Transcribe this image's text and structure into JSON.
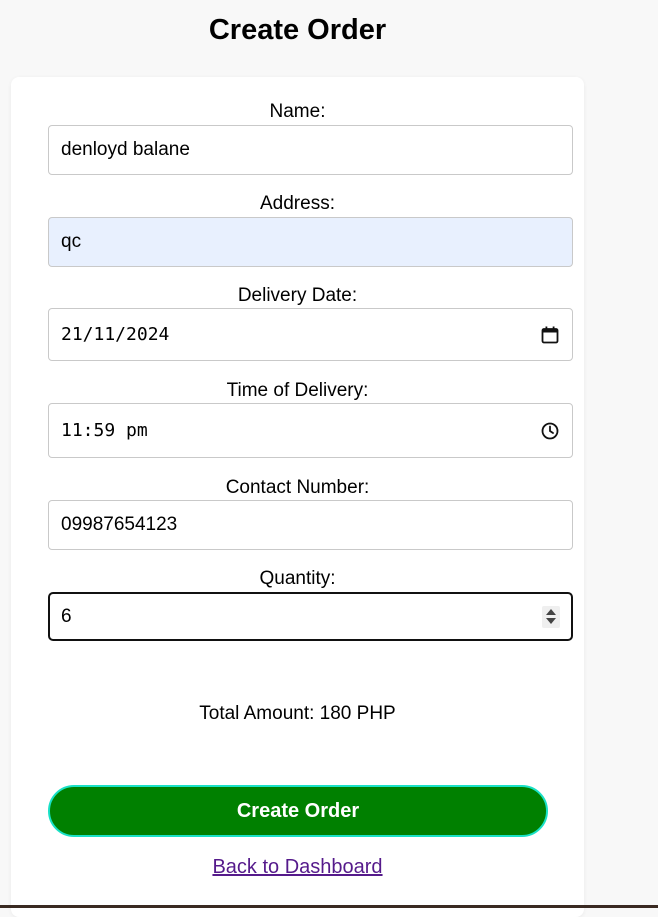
{
  "page": {
    "title": "Create Order"
  },
  "form": {
    "name": {
      "label": "Name:",
      "value": "denloyd balane"
    },
    "address": {
      "label": "Address:",
      "value": "qc"
    },
    "delivery_date": {
      "label": "Delivery Date:",
      "value": "21/11/2024",
      "icon": "calendar-icon"
    },
    "delivery_time": {
      "label": "Time of Delivery:",
      "value": "11:59 pm",
      "icon": "clock-icon"
    },
    "contact": {
      "label": "Contact Number:",
      "value": "09987654123"
    },
    "quantity": {
      "label": "Quantity:",
      "value": "6",
      "icon": "spinner-icon"
    },
    "total": "Total Amount: 180 PHP",
    "submit_label": "Create Order",
    "back_link": "Back to Dashboard"
  },
  "colors": {
    "submit_bg": "#008000",
    "submit_border": "#19e1c6",
    "autofill_bg": "#e8f0fe",
    "link": "#551a8b"
  }
}
